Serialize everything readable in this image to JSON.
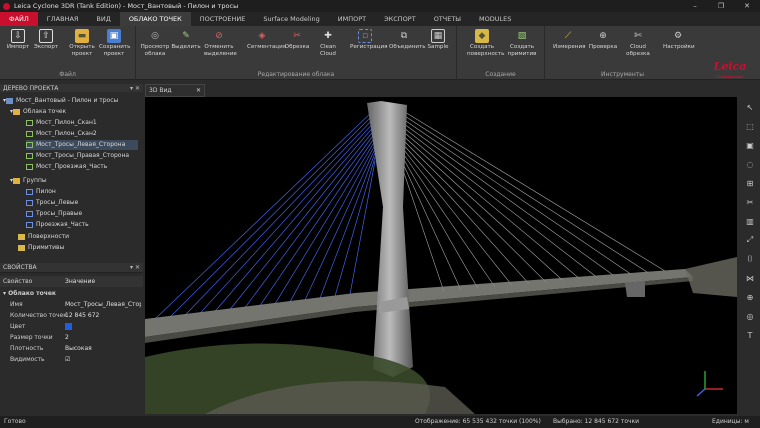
{
  "window": {
    "title": "Leica Cyclone 3DR (Tank Edition) - Мост_Вантовый - Пилон и тросы",
    "controls": [
      "–",
      "❐",
      "✕"
    ]
  },
  "tabs": [
    "ФАЙЛ",
    "ГЛАВНАЯ",
    "ВИД",
    "ОБЛАКО ТОЧЕК",
    "ПОСТРОЕНИЕ",
    "Surface Modeling",
    "ИМПОРТ",
    "ЭКСПОРТ",
    "ОТЧЕТЫ",
    "MODULES"
  ],
  "ribbon": {
    "groups": [
      {
        "label": "Файл",
        "buttons": [
          "Импорт",
          "Экспорт",
          "Открыть проект",
          "Сохранить проект"
        ]
      },
      {
        "label": "Редактирование облака",
        "buttons": [
          "Просмотр облака",
          "Выделить",
          "Отменить выделение",
          "Сегментация",
          "Обрезка",
          "Clean Cloud",
          "Регистрация",
          "Объединить",
          "Sample"
        ]
      },
      {
        "label": "Создание",
        "buttons": [
          "Создать поверхность",
          "Создать примитив"
        ]
      },
      {
        "label": "Инструменты",
        "buttons": [
          "Измерения",
          "Проверка",
          "Cloud обрезка",
          "Настройки"
        ]
      }
    ],
    "logo": "Leica",
    "logo_sub": "Geosystems"
  },
  "tree": {
    "header": "ДЕРЕВО ПРОЕКТА",
    "root": "Мост_Вантовый - Пилон и тросы",
    "folder_clouds": "Облака точек",
    "clouds": [
      "Мост_Пилон_Скан1",
      "Мост_Пилон_Скан2",
      "Мост_Тросы_Левая_Сторона",
      "Мост_Тросы_Правая_Сторона",
      "Мост_Проезжая_Часть"
    ],
    "folder_groups": "Группы",
    "groups": [
      "Пилон",
      "Тросы_Левые",
      "Тросы_Правые",
      "Проезжая_Часть"
    ],
    "surfaces": "Поверхности",
    "primitives": "Примитивы"
  },
  "properties": {
    "header": "СВОЙСТВА",
    "col_prop": "Свойство",
    "col_val": "Значение",
    "section": "Облако точек",
    "rows": [
      {
        "k": "Имя",
        "v": "Мост_Тросы_Левая_Сторона"
      },
      {
        "k": "Количество точек",
        "v": "12 845 672"
      },
      {
        "k": "Цвет",
        "v": ""
      },
      {
        "k": "Размер точки",
        "v": "2"
      },
      {
        "k": "Плотность",
        "v": "Высокая"
      },
      {
        "k": "Видимость",
        "v": "☑"
      }
    ],
    "color": "#1f5fe0"
  },
  "viewport": {
    "tab": "3D Вид"
  },
  "status": {
    "left": "Готово",
    "display": "Отображение: 65 535 432 точки (100%)",
    "selected": "Выбрано: 12 845 672 точки",
    "units": "Единицы: м"
  },
  "colors": {
    "accent": "#c8102e",
    "cable_blue": "#4a6cff"
  }
}
